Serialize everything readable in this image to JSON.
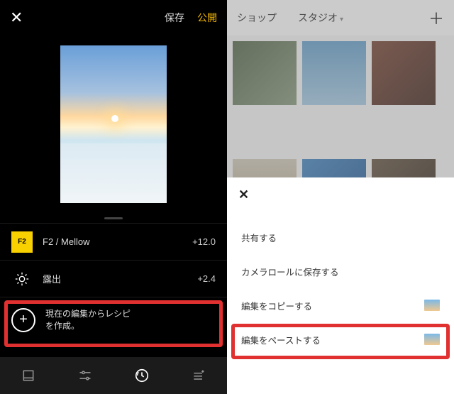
{
  "left": {
    "close_glyph": "✕",
    "save_label": "保存",
    "publish_label": "公開",
    "filter": {
      "code": "F2",
      "name": "F2 / Mellow",
      "value": "+12.0"
    },
    "exposure": {
      "label": "露出",
      "value": "+2.4"
    },
    "recipe": {
      "line1": "現在の編集からレシピ",
      "line2": "を作成。"
    }
  },
  "right": {
    "shop_label": "ショップ",
    "studio_label": "スタジオ",
    "plus_glyph": "＋",
    "sheet": {
      "close_glyph": "✕",
      "items": [
        {
          "label": "共有する",
          "has_thumb": false
        },
        {
          "label": "カメラロールに保存する",
          "has_thumb": false
        },
        {
          "label": "編集をコピーする",
          "has_thumb": true
        },
        {
          "label": "編集をペーストする",
          "has_thumb": true
        }
      ]
    }
  }
}
